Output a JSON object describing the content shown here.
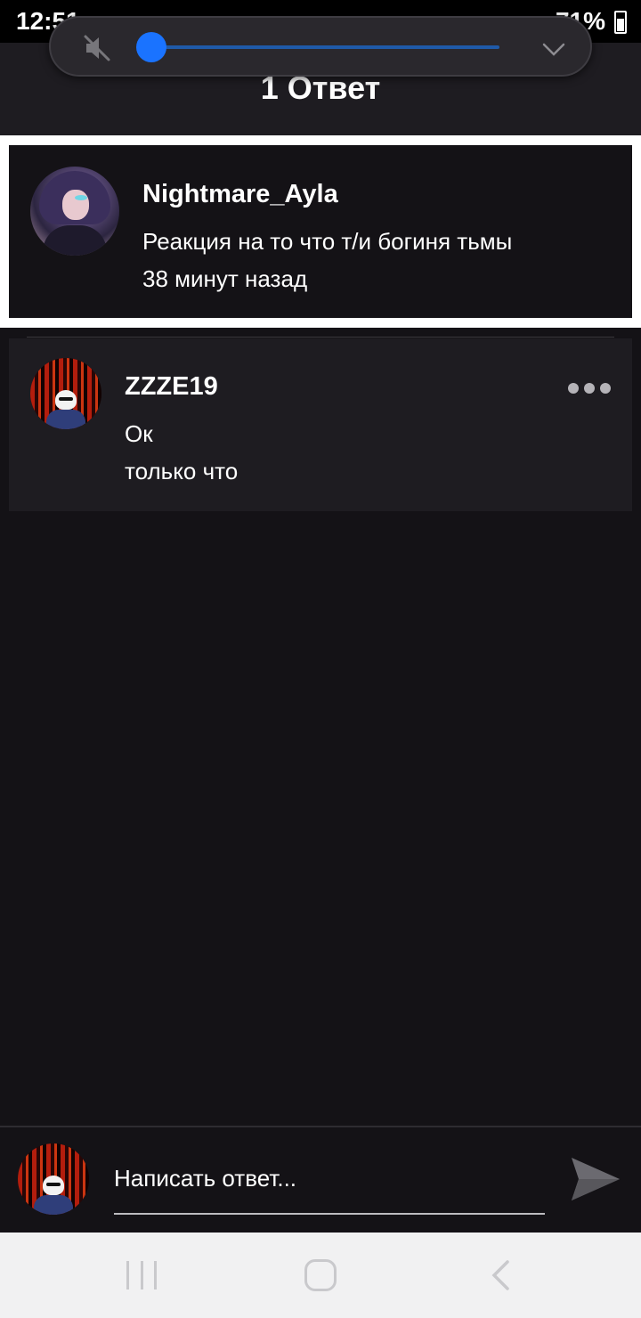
{
  "status_bar": {
    "time": "12:51",
    "battery": "71%"
  },
  "header": {
    "title": "1 Ответ"
  },
  "volume": {
    "level": 0.0,
    "muted": true
  },
  "parent_post": {
    "author": "Nightmare_Ayla",
    "text": "Реакция на то что т/и богиня тьмы",
    "time": "38 минут назад"
  },
  "reply": {
    "author": "ZZZE19",
    "text": "Ок",
    "time": "только что"
  },
  "composer": {
    "placeholder": "Написать ответ..."
  },
  "colors": {
    "background": "#141216",
    "card": "#1e1c21",
    "accent": "#1a73ff"
  }
}
